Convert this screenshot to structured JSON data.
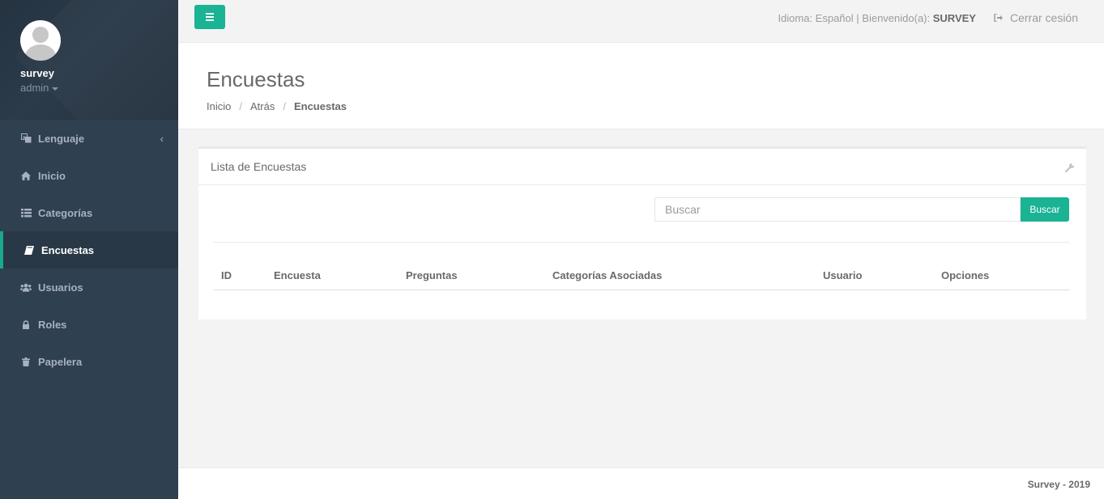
{
  "sidebar": {
    "profile": {
      "name": "survey",
      "role": "admin"
    },
    "items": [
      {
        "label": "Lenguaje",
        "icon": "language-icon",
        "active": false,
        "has_submenu": true
      },
      {
        "label": "Inicio",
        "icon": "home-icon",
        "active": false
      },
      {
        "label": "Categorías",
        "icon": "list-icon",
        "active": false
      },
      {
        "label": "Encuestas",
        "icon": "book-icon",
        "active": true
      },
      {
        "label": "Usuarios",
        "icon": "users-icon",
        "active": false
      },
      {
        "label": "Roles",
        "icon": "lock-icon",
        "active": false
      },
      {
        "label": "Papelera",
        "icon": "trash-icon",
        "active": false
      }
    ]
  },
  "topbar": {
    "language_label": "Idioma: Español",
    "separator": " | ",
    "welcome_label": "Bienvenido(a): ",
    "welcome_user": "SURVEY",
    "logout_label": "Cerrar cesión"
  },
  "page_heading": {
    "title": "Encuestas",
    "breadcrumb": [
      "Inicio",
      "Atrás",
      "Encuestas"
    ],
    "breadcrumb_separator": "/"
  },
  "ibox": {
    "title": "Lista de Encuestas",
    "search": {
      "placeholder": "Buscar",
      "value": "",
      "button_label": "Buscar"
    },
    "table": {
      "columns": [
        "ID",
        "Encuesta",
        "Preguntas",
        "Categorías Asociadas",
        "Usuario",
        "Opciones"
      ],
      "rows": []
    }
  },
  "footer": {
    "text": "Survey - 2019"
  },
  "colors": {
    "sidebar_bg": "#2f4050",
    "accent": "#1ab394",
    "active_border": "#19aa8d",
    "text": "#676a6c"
  }
}
